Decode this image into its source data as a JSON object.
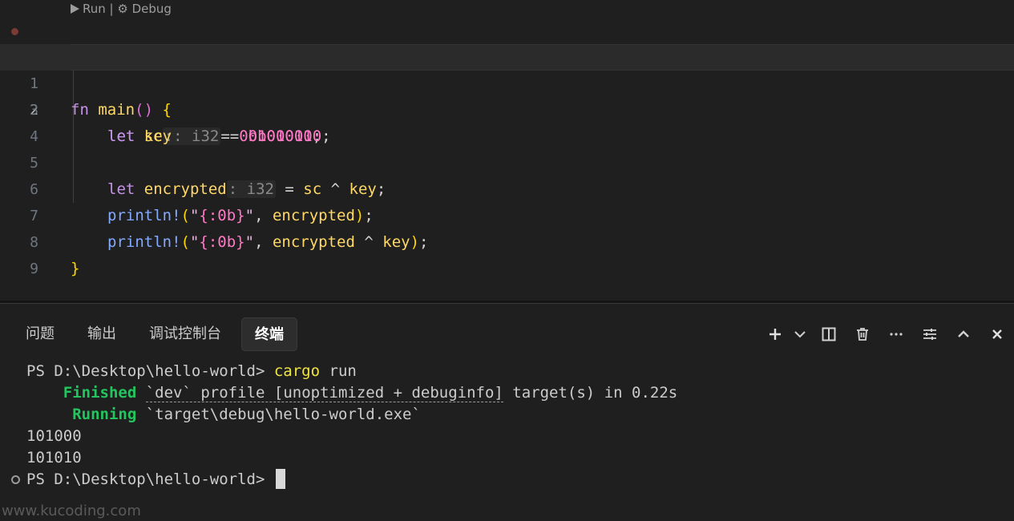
{
  "editor": {
    "codelens": {
      "run": "Run",
      "separator": "|",
      "debug": "Debug"
    },
    "line_numbers": [
      "1",
      "2",
      "3",
      "4",
      "5",
      "6",
      "7",
      "8",
      "9"
    ],
    "tokens": {
      "fn": "fn",
      "main": "main",
      "lparen": "(",
      "rparen": ")",
      "lbrace": "{",
      "rbrace": "}",
      "let": "let",
      "colon": ":",
      "i32": " i32",
      "eq": " = ",
      "semi": ";",
      "sc": "sc",
      "key": "key",
      "encrypted": "encrypted",
      "bin1": "0b101010",
      "bin2": "0b000010",
      "xor": " ^ ",
      "println": "println!",
      "q": "\"",
      "fmt": "{:0b}",
      "comma": ", ",
      "space": " "
    }
  },
  "panel": {
    "tabs": [
      "问题",
      "输出",
      "调试控制台",
      "终端"
    ],
    "actions": [
      "plus-icon",
      "chevron-down-icon",
      "split-icon",
      "trash-icon",
      "more-icon",
      "layout-icon",
      "chevron-up-icon",
      "close-icon"
    ],
    "terminal": {
      "prompt": "PS D:\\Desktop\\hello-world> ",
      "cmd1": "cargo",
      "cmd2": " run",
      "finished_pad": "    ",
      "finished": "Finished",
      "profile_open": " ",
      "profile": "`dev` profile [unoptimized + debuginfo]",
      "finished_rest": " target(s) in 0.22s",
      "running_pad": "     ",
      "running": "Running",
      "running_rest": " `target\\debug\\hello-world.exe`",
      "out1": "101000",
      "out2": "101010"
    }
  },
  "watermark": "www.kucoding.com"
}
